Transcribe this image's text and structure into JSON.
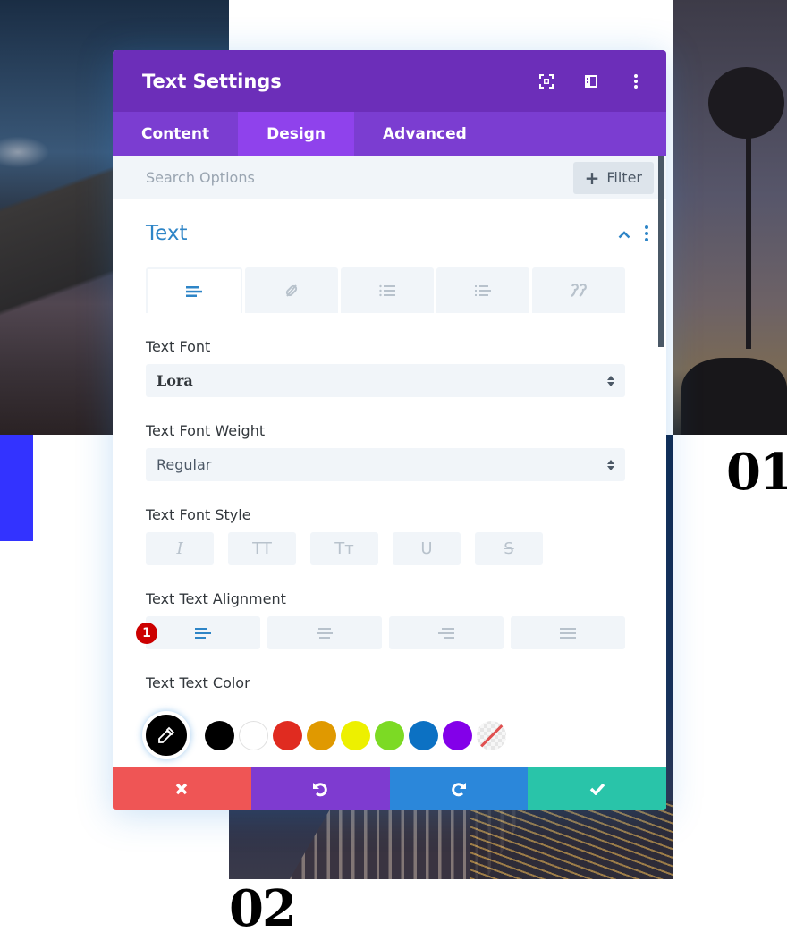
{
  "background": {
    "number_one": "01",
    "number_two": "02"
  },
  "modal": {
    "title": "Text Settings",
    "header_icons": [
      "fullscreen-icon",
      "sidebar-layout-icon",
      "more-vertical-icon"
    ],
    "tabs": [
      {
        "label": "Content",
        "active": false
      },
      {
        "label": "Design",
        "active": true
      },
      {
        "label": "Advanced",
        "active": false
      }
    ],
    "search": {
      "placeholder": "Search Options",
      "value": ""
    },
    "filter_label": "Filter",
    "section": {
      "title": "Text",
      "subtabs": [
        "text-align-icon",
        "link-icon",
        "bullet-list-icon",
        "numbered-list-icon",
        "quote-icon"
      ],
      "active_subtab": 0
    },
    "fields": {
      "font": {
        "label": "Text Font",
        "value": "Lora"
      },
      "weight": {
        "label": "Text Font Weight",
        "value": "Regular"
      },
      "style": {
        "label": "Text Font Style",
        "options": [
          "I",
          "TT",
          "Tт",
          "U",
          "S"
        ]
      },
      "alignment": {
        "label": "Text Text Alignment",
        "options": [
          "left",
          "center",
          "right",
          "justify"
        ],
        "selected": "left",
        "badge": "1"
      },
      "color": {
        "label": "Text Text Color",
        "swatches": [
          "#000000",
          "#ffffff",
          "#e02b20",
          "#e09900",
          "#edf000",
          "#7cda24",
          "#0c71c3",
          "#8300e9",
          "none"
        ]
      }
    },
    "actions": [
      {
        "name": "cancel",
        "color": "#ef5555"
      },
      {
        "name": "undo",
        "color": "#7e3bd0"
      },
      {
        "name": "redo",
        "color": "#2b87da"
      },
      {
        "name": "save",
        "color": "#29c4a9"
      }
    ],
    "colors": {
      "header": "#6c2eb9",
      "tabs": "#7b3dd1",
      "active_tab": "#8f42ec",
      "accent": "#2e85c7"
    }
  }
}
